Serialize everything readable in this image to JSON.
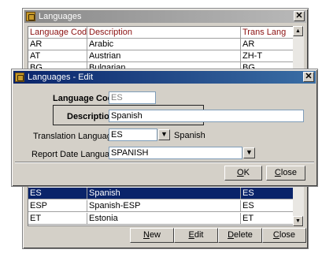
{
  "languages_window": {
    "title": "Languages",
    "columns": [
      "Language Code",
      "Description",
      "Trans Lang"
    ],
    "top_rows": [
      [
        "AR",
        "Arabic",
        "AR"
      ],
      [
        "AT",
        "Austrian",
        "ZH-T"
      ],
      [
        "BG",
        "Bulgarian",
        "BG"
      ]
    ],
    "bottom_rows": [
      [
        "ES",
        "Spanish",
        "ES"
      ],
      [
        "ESP",
        "Spanish-ESP",
        "ES"
      ],
      [
        "ET",
        "Estonia",
        "ET"
      ]
    ],
    "selected_row": "ES",
    "buttons": {
      "new": {
        "u": "N",
        "rest": "ew"
      },
      "edit": {
        "u": "E",
        "rest": "dit"
      },
      "delete": {
        "u": "D",
        "rest": "elete"
      },
      "close": {
        "u": "C",
        "rest": "lose"
      }
    }
  },
  "edit_dialog": {
    "title": "Languages - Edit",
    "language_code_label": "Language Code",
    "language_code_value": "ES",
    "description_label": "Description",
    "description_value": "Spanish",
    "translation_language_label": "Translation Language",
    "translation_language_value": "ES",
    "translation_language_text": "Spanish",
    "report_date_language_label": "Report Date Language",
    "report_date_language_value": "SPANISH",
    "buttons": {
      "ok": {
        "u": "O",
        "rest": "K"
      },
      "close": {
        "u": "C",
        "rest": "lose"
      }
    }
  },
  "icons": [
    "app-icon",
    "close-icon",
    "scroll-up-arrow-icon",
    "scroll-down-arrow-icon",
    "dropdown-arrow-icon"
  ],
  "colors": {
    "active_title": "#0a246a",
    "inactive_title": "#8a8a8a",
    "header_text": "#8b1010",
    "selection": "#0a246a",
    "face": "#d4d0c8"
  }
}
